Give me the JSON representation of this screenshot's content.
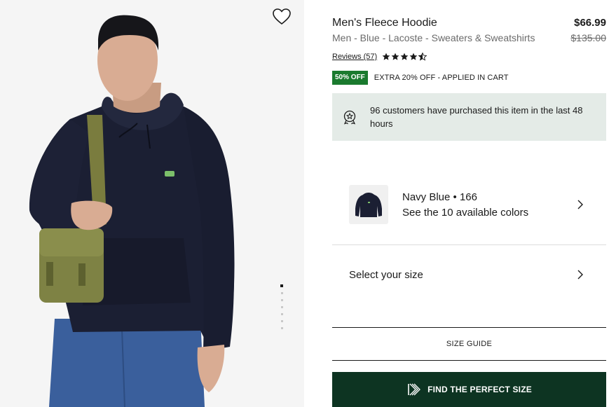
{
  "product": {
    "name": "Men's Fleece Hoodie",
    "price": "$66.99",
    "breadcrumb": "Men - Blue - Lacoste - Sweaters & Sweatshirts",
    "original_price": "$135.00",
    "reviews_label": "Reviews (57)",
    "rating": 4.5,
    "rating_max": 5
  },
  "promo": {
    "badge": "50% OFF",
    "text": "EXTRA 20% OFF - APPLIED IN CART"
  },
  "notice": {
    "text": "96 customers have purchased this item in the last 48 hours",
    "icon": "award-icon"
  },
  "color": {
    "line1": "Navy Blue • 166",
    "line2": "See the 10 available colors"
  },
  "size": {
    "label": "Select your size"
  },
  "buttons": {
    "size_guide": "SIZE GUIDE",
    "perfect_size": "FIND THE PERFECT SIZE"
  },
  "gallery": {
    "image_count": 7,
    "active_index": 0
  },
  "colors": {
    "promo_badge": "#1a7a2e",
    "notice_bg": "#e4ebe7",
    "cta_bg": "#0d3422",
    "hoodie": "#1b1f33"
  }
}
